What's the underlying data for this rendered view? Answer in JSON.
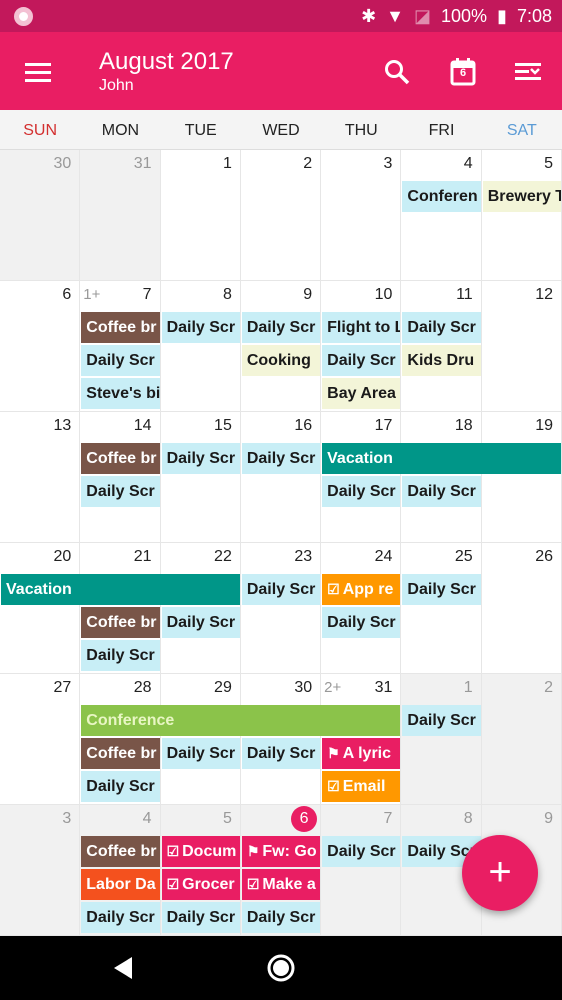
{
  "status": {
    "battery": "100%",
    "time": "7:08"
  },
  "header": {
    "title": "August 2017",
    "subtitle": "John",
    "icons": [
      "menu-icon",
      "search-icon",
      "today-calendar-icon",
      "view-options-icon"
    ],
    "today_badge": "6"
  },
  "weekdays": [
    "SUN",
    "MON",
    "TUE",
    "WED",
    "THU",
    "FRI",
    "SAT"
  ],
  "colors": {
    "primary": "#e91e63",
    "status": "#c2185b",
    "sun": "#d32f2f",
    "sat": "#5b9bd5",
    "blue": "#c8eef6",
    "yellow": "#f3f5d8",
    "brown": "#795548",
    "teal": "#009688",
    "green": "#8bc34a",
    "orange": "#ff9800",
    "pink": "#e91e63",
    "red": "#f4511e"
  },
  "weeks": [
    {
      "days": [
        "30",
        "31",
        "1",
        "2",
        "3",
        "4",
        "5"
      ],
      "out": [
        0,
        1
      ],
      "more": {}
    },
    {
      "days": [
        "6",
        "7",
        "8",
        "9",
        "10",
        "11",
        "12"
      ],
      "out": [],
      "more": {
        "1": "1+"
      }
    },
    {
      "days": [
        "13",
        "14",
        "15",
        "16",
        "17",
        "18",
        "19"
      ],
      "out": [],
      "more": {}
    },
    {
      "days": [
        "20",
        "21",
        "22",
        "23",
        "24",
        "25",
        "26"
      ],
      "out": [],
      "more": {}
    },
    {
      "days": [
        "27",
        "28",
        "29",
        "30",
        "31",
        "1",
        "2"
      ],
      "out": [
        5,
        6
      ],
      "more": {
        "4": "2+"
      }
    },
    {
      "days": [
        "3",
        "4",
        "5",
        "6",
        "7",
        "8",
        "9"
      ],
      "out": [
        0,
        1,
        2,
        3,
        4,
        5,
        6
      ],
      "more": {},
      "today": 3
    }
  ],
  "events": [
    {
      "w": 0,
      "c": 5,
      "s": 1,
      "l": 0,
      "label": "Conferen",
      "color": "blue"
    },
    {
      "w": 0,
      "c": 6,
      "s": 1,
      "l": 0,
      "label": "Brewery T",
      "color": "yellow"
    },
    {
      "w": 1,
      "c": 1,
      "s": 1,
      "l": 0,
      "label": "Coffee br",
      "color": "brown"
    },
    {
      "w": 1,
      "c": 2,
      "s": 1,
      "l": 0,
      "label": "Daily Scr",
      "color": "blue"
    },
    {
      "w": 1,
      "c": 3,
      "s": 1,
      "l": 0,
      "label": "Daily Scr",
      "color": "blue"
    },
    {
      "w": 1,
      "c": 4,
      "s": 1,
      "l": 0,
      "label": "Flight to L",
      "color": "blue"
    },
    {
      "w": 1,
      "c": 5,
      "s": 1,
      "l": 0,
      "label": "Daily Scr",
      "color": "blue"
    },
    {
      "w": 1,
      "c": 1,
      "s": 1,
      "l": 1,
      "label": "Daily Scr",
      "color": "blue"
    },
    {
      "w": 1,
      "c": 3,
      "s": 1,
      "l": 1,
      "label": "Cooking",
      "color": "yellow"
    },
    {
      "w": 1,
      "c": 4,
      "s": 1,
      "l": 1,
      "label": "Daily Scr",
      "color": "blue"
    },
    {
      "w": 1,
      "c": 5,
      "s": 1,
      "l": 1,
      "label": "Kids Dru",
      "color": "yellow"
    },
    {
      "w": 1,
      "c": 1,
      "s": 1,
      "l": 2,
      "label": "Steve's bi",
      "color": "blue"
    },
    {
      "w": 1,
      "c": 4,
      "s": 1,
      "l": 2,
      "label": "Bay Area",
      "color": "yellow"
    },
    {
      "w": 2,
      "c": 1,
      "s": 1,
      "l": 0,
      "label": "Coffee br",
      "color": "brown"
    },
    {
      "w": 2,
      "c": 2,
      "s": 1,
      "l": 0,
      "label": "Daily Scr",
      "color": "blue"
    },
    {
      "w": 2,
      "c": 3,
      "s": 1,
      "l": 0,
      "label": "Daily Scr",
      "color": "blue"
    },
    {
      "w": 2,
      "c": 4,
      "s": 3,
      "l": 0,
      "label": "Vacation",
      "color": "teal"
    },
    {
      "w": 2,
      "c": 1,
      "s": 1,
      "l": 1,
      "label": "Daily Scr",
      "color": "blue"
    },
    {
      "w": 2,
      "c": 4,
      "s": 1,
      "l": 1,
      "label": "Daily Scr",
      "color": "blue"
    },
    {
      "w": 2,
      "c": 5,
      "s": 1,
      "l": 1,
      "label": "Daily Scr",
      "color": "blue"
    },
    {
      "w": 3,
      "c": 0,
      "s": 3,
      "l": 0,
      "label": "Vacation",
      "color": "teal"
    },
    {
      "w": 3,
      "c": 3,
      "s": 1,
      "l": 0,
      "label": "Daily Scr",
      "color": "blue"
    },
    {
      "w": 3,
      "c": 4,
      "s": 1,
      "l": 0,
      "label": "App re",
      "color": "orange",
      "icon": "check"
    },
    {
      "w": 3,
      "c": 5,
      "s": 1,
      "l": 0,
      "label": "Daily Scr",
      "color": "blue"
    },
    {
      "w": 3,
      "c": 1,
      "s": 1,
      "l": 1,
      "label": "Coffee br",
      "color": "brown"
    },
    {
      "w": 3,
      "c": 2,
      "s": 1,
      "l": 1,
      "label": "Daily Scr",
      "color": "blue"
    },
    {
      "w": 3,
      "c": 4,
      "s": 1,
      "l": 1,
      "label": "Daily Scr",
      "color": "blue"
    },
    {
      "w": 3,
      "c": 1,
      "s": 1,
      "l": 2,
      "label": "Daily Scr",
      "color": "blue"
    },
    {
      "w": 4,
      "c": 1,
      "s": 4,
      "l": 0,
      "label": "Conference",
      "color": "green"
    },
    {
      "w": 4,
      "c": 5,
      "s": 1,
      "l": 0,
      "label": "Daily Scr",
      "color": "blue"
    },
    {
      "w": 4,
      "c": 1,
      "s": 1,
      "l": 1,
      "label": "Coffee br",
      "color": "brown"
    },
    {
      "w": 4,
      "c": 2,
      "s": 1,
      "l": 1,
      "label": "Daily Scr",
      "color": "blue"
    },
    {
      "w": 4,
      "c": 3,
      "s": 1,
      "l": 1,
      "label": "Daily Scr",
      "color": "blue"
    },
    {
      "w": 4,
      "c": 4,
      "s": 1,
      "l": 1,
      "label": "A lyric",
      "color": "pink",
      "icon": "flag"
    },
    {
      "w": 4,
      "c": 1,
      "s": 1,
      "l": 2,
      "label": "Daily Scr",
      "color": "blue"
    },
    {
      "w": 4,
      "c": 4,
      "s": 1,
      "l": 2,
      "label": "Email",
      "color": "orange",
      "icon": "check"
    },
    {
      "w": 5,
      "c": 1,
      "s": 1,
      "l": 0,
      "label": "Coffee br",
      "color": "brown"
    },
    {
      "w": 5,
      "c": 2,
      "s": 1,
      "l": 0,
      "label": "Docum",
      "color": "pink",
      "icon": "check"
    },
    {
      "w": 5,
      "c": 3,
      "s": 1,
      "l": 0,
      "label": "Fw: Go",
      "color": "pink",
      "icon": "flag"
    },
    {
      "w": 5,
      "c": 4,
      "s": 1,
      "l": 0,
      "label": "Daily Scr",
      "color": "blue"
    },
    {
      "w": 5,
      "c": 5,
      "s": 1,
      "l": 0,
      "label": "Daily Scr",
      "color": "blue"
    },
    {
      "w": 5,
      "c": 1,
      "s": 1,
      "l": 1,
      "label": "Labor Da",
      "color": "red"
    },
    {
      "w": 5,
      "c": 2,
      "s": 1,
      "l": 1,
      "label": "Grocer",
      "color": "pink",
      "icon": "check"
    },
    {
      "w": 5,
      "c": 3,
      "s": 1,
      "l": 1,
      "label": "Make a",
      "color": "pink",
      "icon": "check"
    },
    {
      "w": 5,
      "c": 1,
      "s": 1,
      "l": 2,
      "label": "Daily Scr",
      "color": "blue"
    },
    {
      "w": 5,
      "c": 2,
      "s": 1,
      "l": 2,
      "label": "Daily Scr",
      "color": "blue"
    },
    {
      "w": 5,
      "c": 3,
      "s": 1,
      "l": 2,
      "label": "Daily Scr",
      "color": "blue"
    }
  ],
  "fab": {
    "label": "+"
  }
}
